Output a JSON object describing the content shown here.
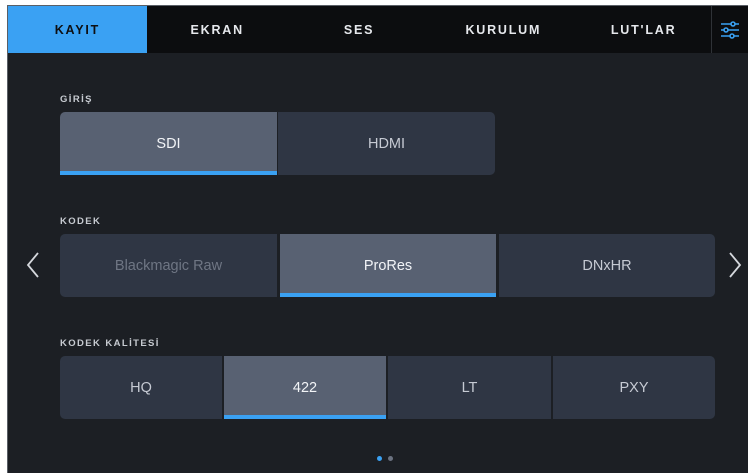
{
  "tabs": [
    {
      "label": "KAYIT",
      "active": true
    },
    {
      "label": "EKRAN",
      "active": false
    },
    {
      "label": "SES",
      "active": false
    },
    {
      "label": "KURULUM",
      "active": false
    },
    {
      "label": "LUT'LAR",
      "active": false
    }
  ],
  "menu_icon": "sliders-icon",
  "colors": {
    "accent": "#3aa1f3",
    "background": "#1c1f24",
    "button": "#2f3644",
    "button_selected": "#586172"
  },
  "giris": {
    "label": "GİRİŞ",
    "options": [
      "SDI",
      "HDMI"
    ],
    "selected": "SDI"
  },
  "kodek": {
    "label": "KODEK",
    "options": [
      "Blackmagic Raw",
      "ProRes",
      "DNxHR"
    ],
    "selected": "ProRes",
    "disabled": [
      "Blackmagic Raw"
    ]
  },
  "kodek_kalitesi": {
    "label": "KODEK KALİTESİ",
    "options": [
      "HQ",
      "422",
      "LT",
      "PXY"
    ],
    "selected": "422"
  },
  "pagination": {
    "pages": 2,
    "current": 1
  },
  "nav": {
    "prev_icon": "chevron-left-icon",
    "next_icon": "chevron-right-icon"
  }
}
